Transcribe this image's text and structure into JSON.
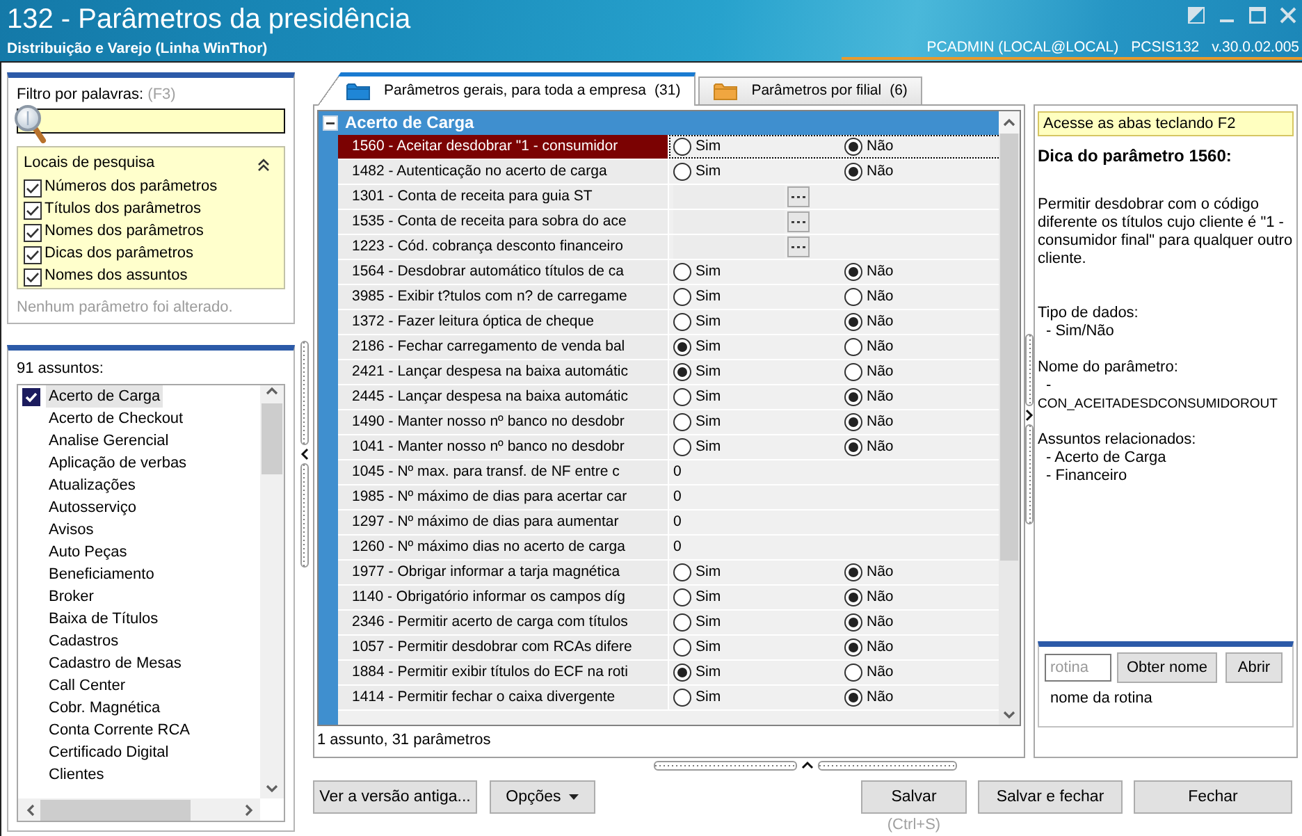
{
  "window": {
    "title": "132 - Parâmetros da presidência",
    "subtitle": "Distribuição e Varejo (Linha WinThor)",
    "user": "PCADMIN (LOCAL@LOCAL)",
    "program": "PCSIS132",
    "version": "v.30.0.02.005"
  },
  "filter": {
    "label": "Filtro por palavras:",
    "shortcut": "(F3)",
    "search_locations": {
      "title": "Locais de pesquisa",
      "expanded": true,
      "options": [
        {
          "label": "Números dos parâmetros",
          "checked": true
        },
        {
          "label": "Títulos dos parâmetros",
          "checked": true
        },
        {
          "label": "Nomes dos parâmetros",
          "checked": true
        },
        {
          "label": "Dicas dos parâmetros",
          "checked": true
        },
        {
          "label": "Nomes dos assuntos",
          "checked": true
        }
      ]
    },
    "status": "Nenhum parâmetro foi alterado."
  },
  "subjects": {
    "count": "91 assuntos:",
    "items": [
      {
        "label": "Acerto de Carga",
        "checked": true,
        "selected": true
      },
      {
        "label": "Acerto de Checkout",
        "checked": false,
        "selected": false
      },
      {
        "label": "Analise Gerencial",
        "checked": false,
        "selected": false
      },
      {
        "label": "Aplicação de verbas",
        "checked": false,
        "selected": false
      },
      {
        "label": "Atualizações",
        "checked": false,
        "selected": false
      },
      {
        "label": "Autosserviço",
        "checked": false,
        "selected": false
      },
      {
        "label": "Avisos",
        "checked": false,
        "selected": false
      },
      {
        "label": "Auto Peças",
        "checked": false,
        "selected": false
      },
      {
        "label": "Beneficiamento",
        "checked": false,
        "selected": false
      },
      {
        "label": "Broker",
        "checked": false,
        "selected": false
      },
      {
        "label": "Baixa de Títulos",
        "checked": false,
        "selected": false
      },
      {
        "label": "Cadastros",
        "checked": false,
        "selected": false
      },
      {
        "label": "Cadastro de Mesas",
        "checked": false,
        "selected": false
      },
      {
        "label": "Call Center",
        "checked": false,
        "selected": false
      },
      {
        "label": "Cobr. Magnética",
        "checked": false,
        "selected": false
      },
      {
        "label": "Conta Corrente RCA",
        "checked": false,
        "selected": false
      },
      {
        "label": "Certificado Digital",
        "checked": false,
        "selected": false
      },
      {
        "label": "Clientes",
        "checked": false,
        "selected": false
      }
    ]
  },
  "tabs": [
    {
      "label": "Parâmetros gerais, para toda a empresa",
      "count": "(31)",
      "selected": true
    },
    {
      "label": "Parâmetros por filial",
      "count": "(6)",
      "selected": false
    }
  ],
  "grid": {
    "group": {
      "title": "Acerto de Carga",
      "expanded": true
    },
    "rows": [
      {
        "label": "1560 - Aceitar desdobrar \"1 - consumidor",
        "kind": "yesno",
        "selected": true,
        "options": [
          {
            "label": "Sim",
            "selected": false
          },
          {
            "label": "Não",
            "selected": true
          }
        ]
      },
      {
        "label": "1482 - Autenticação no acerto de carga",
        "kind": "yesno",
        "selected": false,
        "options": [
          {
            "label": "Sim",
            "selected": false
          },
          {
            "label": "Não",
            "selected": true
          }
        ]
      },
      {
        "label": "1301 - Conta de receita para guia ST",
        "kind": "lookup",
        "selected": false
      },
      {
        "label": "1535 - Conta de receita para sobra do ace",
        "kind": "lookup",
        "selected": false
      },
      {
        "label": "1223 - Cód. cobrança desconto financeiro",
        "kind": "lookup",
        "selected": false
      },
      {
        "label": "1564 - Desdobrar automático títulos de ca",
        "kind": "yesno",
        "selected": false,
        "options": [
          {
            "label": "Sim",
            "selected": false
          },
          {
            "label": "Não",
            "selected": true
          }
        ]
      },
      {
        "label": "3985 - Exibir t?tulos com n? de carregame",
        "kind": "yesno",
        "selected": false,
        "options": [
          {
            "label": "Sim",
            "selected": false
          },
          {
            "label": "Não",
            "selected": false
          }
        ]
      },
      {
        "label": "1372 - Fazer leitura óptica de cheque",
        "kind": "yesno",
        "selected": false,
        "options": [
          {
            "label": "Sim",
            "selected": false
          },
          {
            "label": "Não",
            "selected": true
          }
        ]
      },
      {
        "label": "2186 - Fechar carregamento de venda bal",
        "kind": "yesno",
        "selected": false,
        "options": [
          {
            "label": "Sim",
            "selected": true
          },
          {
            "label": "Não",
            "selected": false
          }
        ]
      },
      {
        "label": "2421 - Lançar despesa na baixa automátic",
        "kind": "yesno",
        "selected": false,
        "options": [
          {
            "label": "Sim",
            "selected": true
          },
          {
            "label": "Não",
            "selected": false
          }
        ]
      },
      {
        "label": "2445 - Lançar despesa na baixa automátic",
        "kind": "yesno",
        "selected": false,
        "options": [
          {
            "label": "Sim",
            "selected": false
          },
          {
            "label": "Não",
            "selected": true
          }
        ]
      },
      {
        "label": "1490 - Manter nosso nº banco no desdobr",
        "kind": "yesno",
        "selected": false,
        "options": [
          {
            "label": "Sim",
            "selected": false
          },
          {
            "label": "Não",
            "selected": true
          }
        ]
      },
      {
        "label": "1041 - Manter nosso nº banco no desdobr",
        "kind": "yesno",
        "selected": false,
        "options": [
          {
            "label": "Sim",
            "selected": false
          },
          {
            "label": "Não",
            "selected": true
          }
        ]
      },
      {
        "label": "1045 - Nº max. para transf. de NF entre c",
        "kind": "number",
        "selected": false,
        "value": "0"
      },
      {
        "label": "1985 - Nº máximo de dias para acertar car",
        "kind": "number",
        "selected": false,
        "value": "0"
      },
      {
        "label": "1297 - Nº máximo de dias para aumentar",
        "kind": "number",
        "selected": false,
        "value": "0"
      },
      {
        "label": "1260 - Nº máximo dias no acerto de carga",
        "kind": "number",
        "selected": false,
        "value": "0"
      },
      {
        "label": "1977 - Obrigar informar a tarja magnética",
        "kind": "yesno",
        "selected": false,
        "options": [
          {
            "label": "Sim",
            "selected": false
          },
          {
            "label": "Não",
            "selected": true
          }
        ]
      },
      {
        "label": "1140 - Obrigatório informar os campos díg",
        "kind": "yesno",
        "selected": false,
        "options": [
          {
            "label": "Sim",
            "selected": false
          },
          {
            "label": "Não",
            "selected": true
          }
        ]
      },
      {
        "label": "2346 - Permitir acerto de carga com títulos",
        "kind": "yesno",
        "selected": false,
        "options": [
          {
            "label": "Sim",
            "selected": false
          },
          {
            "label": "Não",
            "selected": true
          }
        ]
      },
      {
        "label": "1057 - Permitir desdobrar com RCAs difere",
        "kind": "yesno",
        "selected": false,
        "options": [
          {
            "label": "Sim",
            "selected": false
          },
          {
            "label": "Não",
            "selected": true
          }
        ]
      },
      {
        "label": "1884 - Permitir exibir títulos do ECF na roti",
        "kind": "yesno",
        "selected": false,
        "options": [
          {
            "label": "Sim",
            "selected": true
          },
          {
            "label": "Não",
            "selected": false
          }
        ]
      },
      {
        "label": "1414 - Permitir fechar o caixa divergente",
        "kind": "yesno",
        "selected": false,
        "options": [
          {
            "label": "Sim",
            "selected": false
          },
          {
            "label": "Não",
            "selected": true
          }
        ]
      }
    ],
    "summary": "1 assunto, 31 parâmetros"
  },
  "hint": {
    "tab_hint": "Acesse as abas teclando F2",
    "title": "Dica do parâmetro 1560:",
    "description": "Permitir desdobrar com o código diferente os títulos cujo cliente é \"1 - consumidor final\" para qualquer outro cliente.",
    "sections": [
      {
        "heading": "Tipo de dados:",
        "items": [
          "- Sim/Não"
        ]
      },
      {
        "heading": "Nome do parâmetro:",
        "items": [
          "-"
        ],
        "identifier": "CON_ACEITADESDCONSUMIDOROUT"
      },
      {
        "heading": "Assuntos relacionados:",
        "items": [
          "- Acerto de Carga",
          "- Financeiro"
        ]
      }
    ]
  },
  "routine": {
    "placeholder": "rotina",
    "buttons": [
      "Obter nome",
      "Abrir"
    ],
    "result": "nome da rotina"
  },
  "actions": {
    "left": [
      {
        "label": "Ver a versão antiga...",
        "kind": "button"
      },
      {
        "label": "Opções",
        "kind": "dropdown"
      }
    ],
    "right": [
      {
        "label": "Salvar",
        "shortcut": "(Ctrl+S)"
      },
      {
        "label": "Salvar e fechar"
      },
      {
        "label": "Fechar"
      }
    ]
  }
}
